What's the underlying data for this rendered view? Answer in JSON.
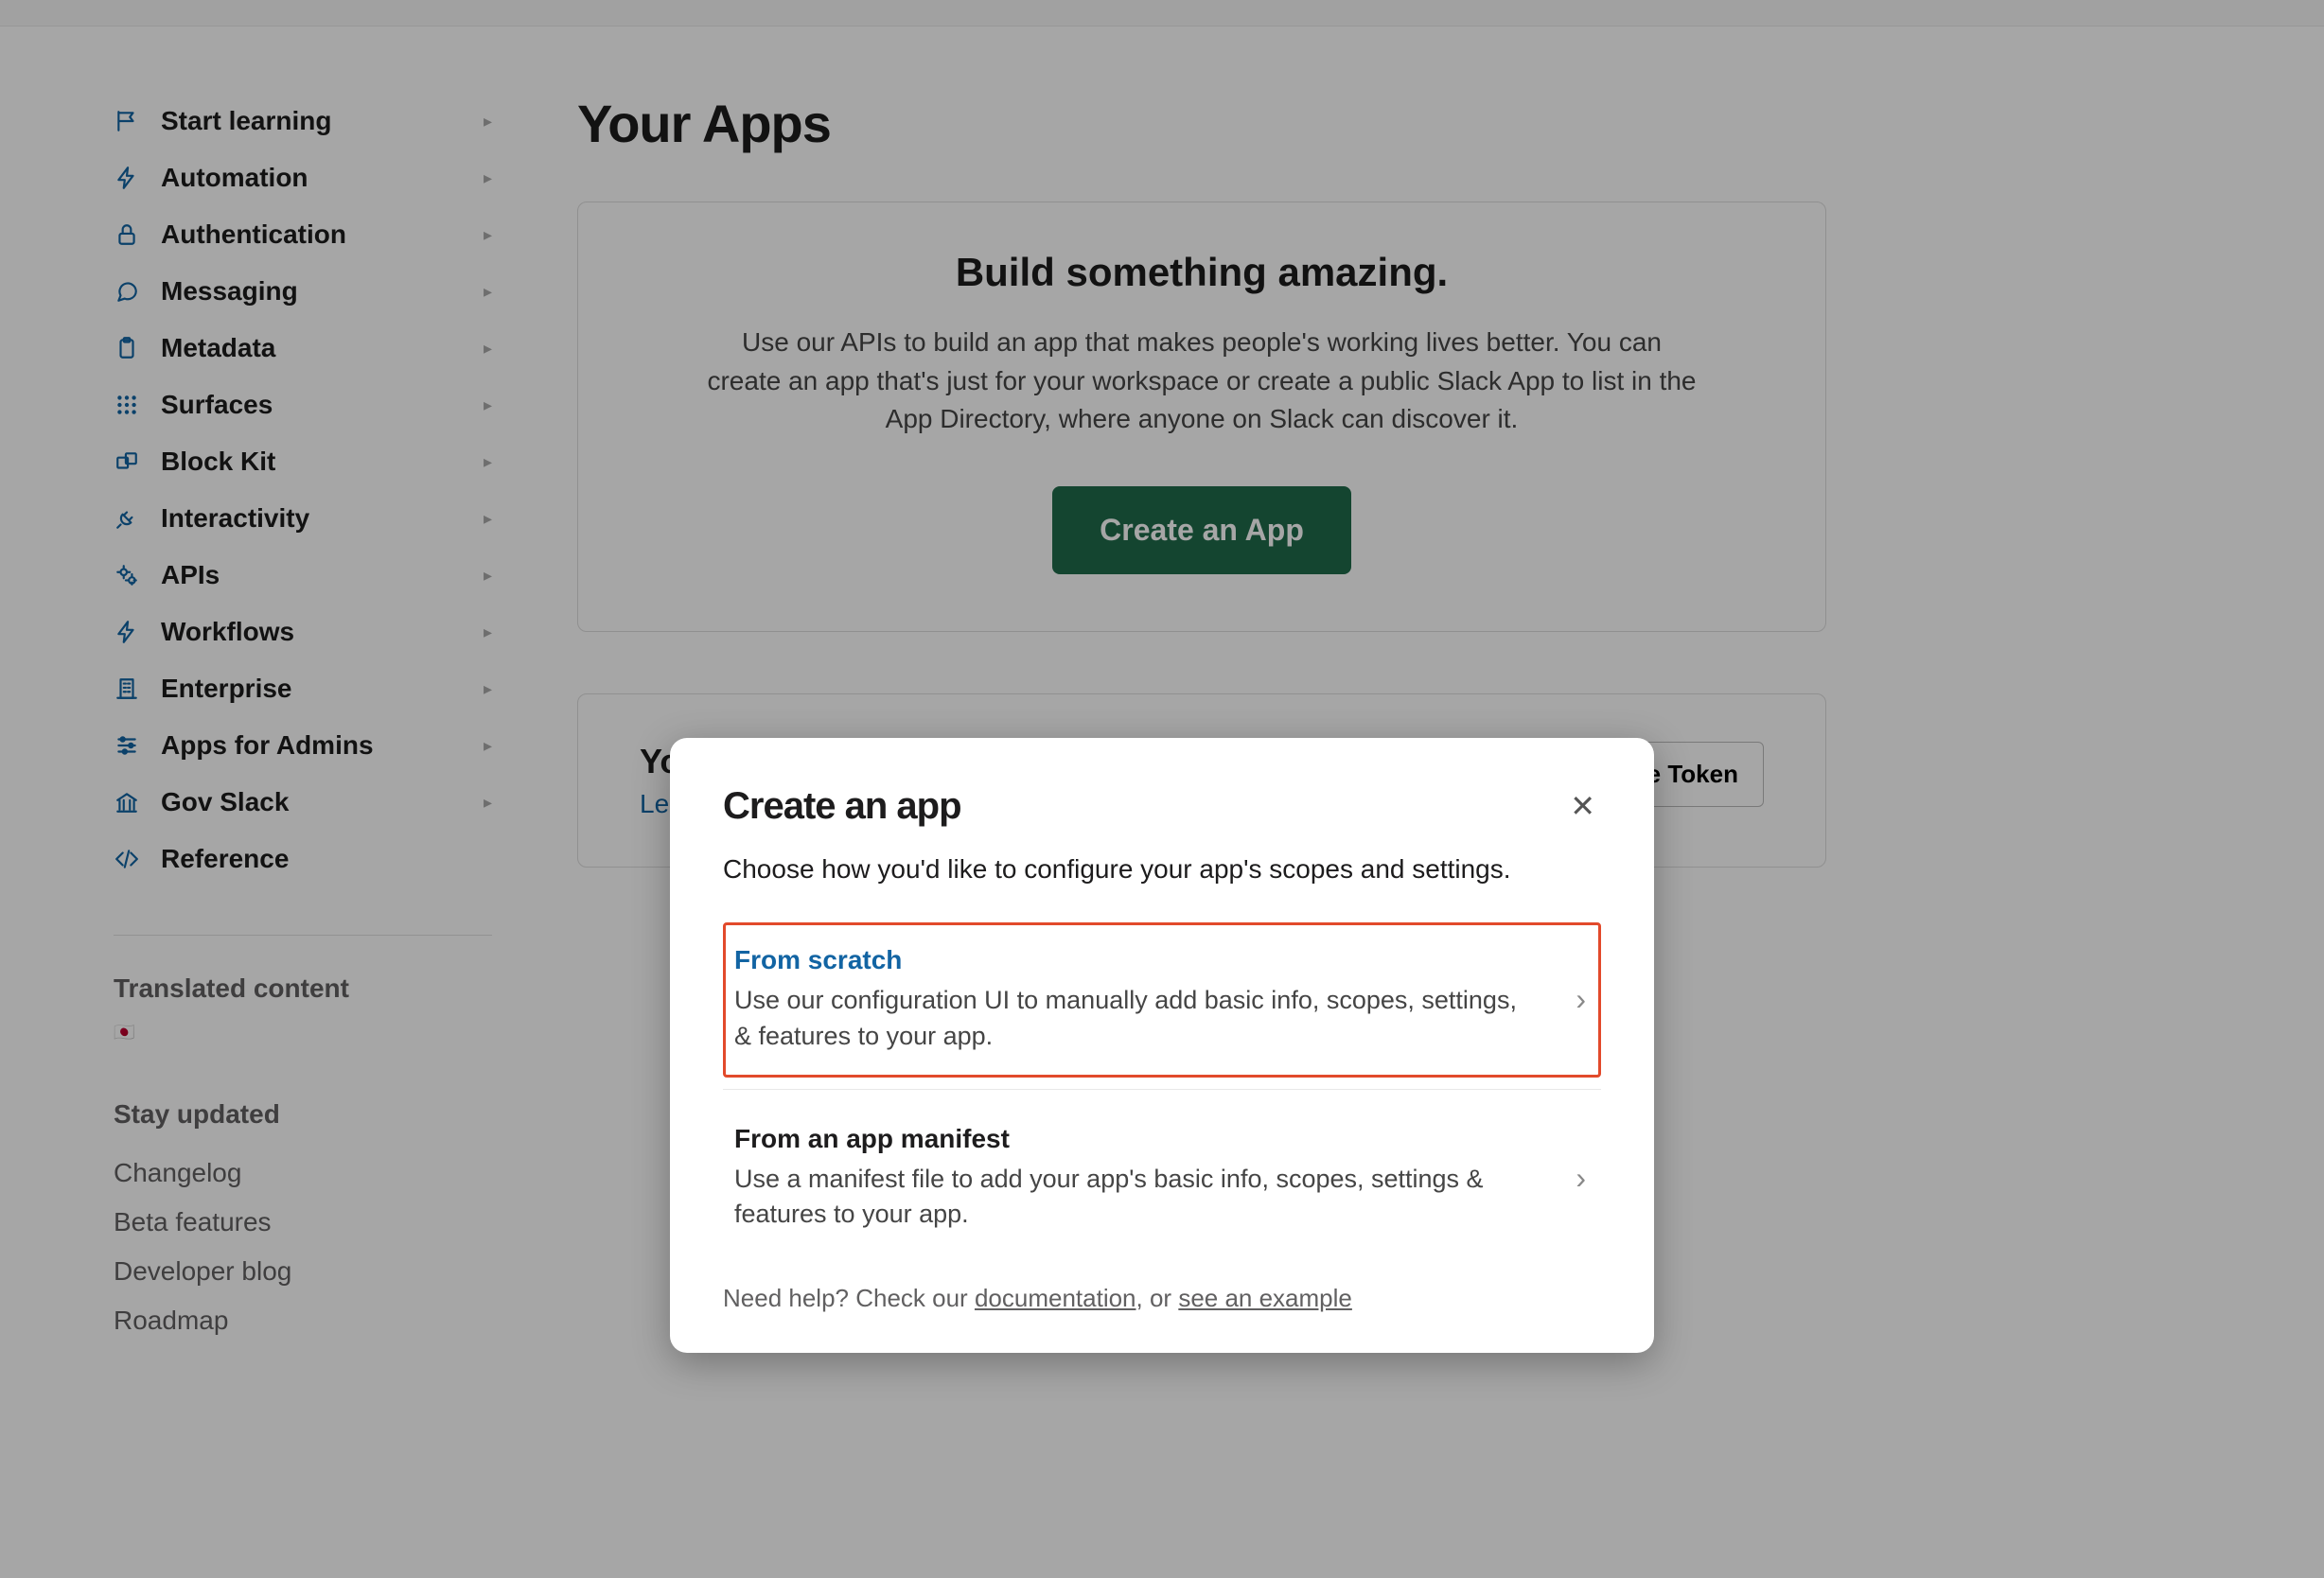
{
  "sidebar": {
    "items": [
      {
        "icon": "flag-icon",
        "label": "Start learning"
      },
      {
        "icon": "bolt-icon",
        "label": "Automation"
      },
      {
        "icon": "lock-icon",
        "label": "Authentication"
      },
      {
        "icon": "speech-icon",
        "label": "Messaging"
      },
      {
        "icon": "clipboard-icon",
        "label": "Metadata"
      },
      {
        "icon": "grid-icon",
        "label": "Surfaces"
      },
      {
        "icon": "blocks-icon",
        "label": "Block Kit"
      },
      {
        "icon": "plug-icon",
        "label": "Interactivity"
      },
      {
        "icon": "gears-icon",
        "label": "APIs"
      },
      {
        "icon": "bolt-icon",
        "label": "Workflows"
      },
      {
        "icon": "building-icon",
        "label": "Enterprise"
      },
      {
        "icon": "sliders-icon",
        "label": "Apps for Admins"
      },
      {
        "icon": "gov-icon",
        "label": "Gov Slack"
      },
      {
        "icon": "code-icon",
        "label": "Reference",
        "no_chevron": true
      }
    ],
    "translated_title": "Translated content",
    "translated_flag": "🇯🇵",
    "stay_updated_title": "Stay updated",
    "links": [
      "Changelog",
      "Beta features",
      "Developer blog",
      "Roadmap"
    ]
  },
  "main": {
    "page_title": "Your Apps",
    "hero_title": "Build something amazing.",
    "hero_desc": "Use our APIs to build an app that makes people's working lives better. You can create an app that's just for your workspace or create a public Slack App to list in the App Directory, where anyone on Slack can discover it.",
    "create_button": "Create an App",
    "apps_title": "Your Apps",
    "apps_learn": "Learn about",
    "token_button": "Generate Token"
  },
  "modal": {
    "title": "Create an app",
    "subtitle": "Choose how you'd like to configure your app's scopes and settings.",
    "option1_title": "From scratch",
    "option1_desc": "Use our configuration UI to manually add basic info, scopes, settings, & features to your app.",
    "option2_title": "From an app manifest",
    "option2_desc": "Use a manifest file to add your app's basic info, scopes, settings & features to your app.",
    "footer_prefix": "Need help? Check our ",
    "footer_doc": "documentation",
    "footer_mid": ", or ",
    "footer_example": "see an example"
  }
}
